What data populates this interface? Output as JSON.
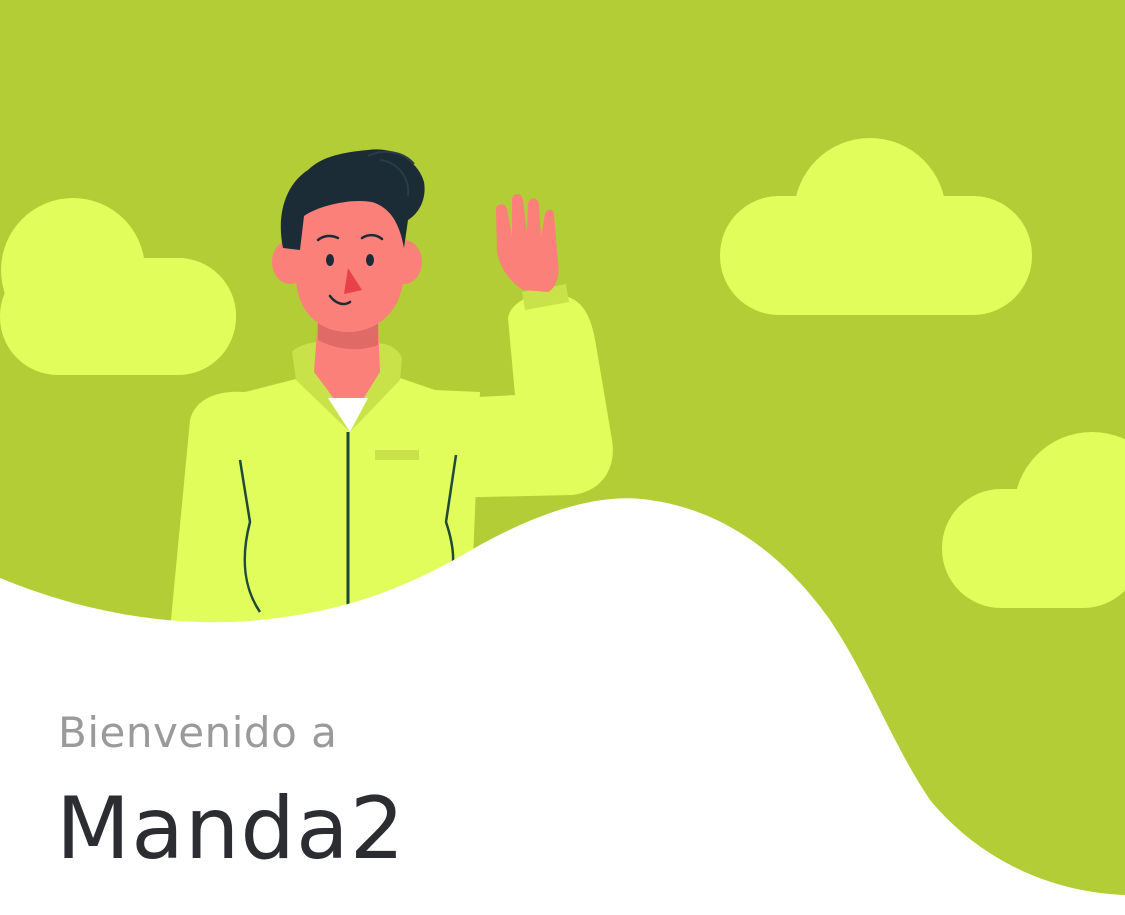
{
  "welcome": {
    "greeting": "Bienvenido a",
    "app_name": "Manda2"
  },
  "colors": {
    "background_green": "#b2cd35",
    "cloud": "#e0fd5b",
    "jacket": "#e0fd5b",
    "jacket_shadow": "#c9e24a",
    "skin": "#fb8079",
    "skin_shadow": "#e06a66",
    "hair": "#1c2c36",
    "shirt": "#ffffff",
    "greeting_text": "#9a9a9a",
    "title_text": "#2b2d33"
  },
  "icons": {
    "illustration": "waving-man-with-clouds"
  }
}
